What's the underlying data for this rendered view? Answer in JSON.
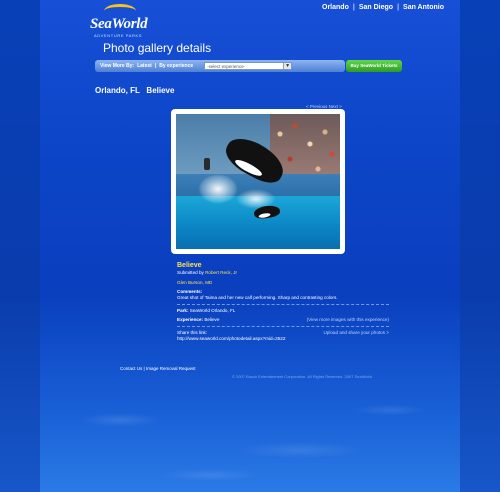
{
  "brand": {
    "logo_text": "SeaWorld",
    "logo_sub": "ADVENTURE PARKS"
  },
  "top_nav": {
    "links": [
      "Orlando",
      "San Diego",
      "San Antonio"
    ],
    "separator": "|"
  },
  "page_title": "Photo gallery details",
  "toolbar": {
    "view_more_label": "View More By:",
    "latest": "Latest",
    "separator": "|",
    "by_experience": "By experience",
    "select_value": "-select experience-",
    "select_arrow": "▼",
    "tickets_button": "Buy SeaWorld Tickets"
  },
  "heading": "Orlando, FL   Believe",
  "pager": {
    "previous": "< Previous",
    "next": "Next >"
  },
  "photo": {
    "title": "Believe",
    "submitted_label": "Submitted by",
    "submitted_by": "Robert Reck, Jr",
    "author_credit": "Glen Burson, MD",
    "comments_label": "Comments:",
    "comments": "Great shot of Taima and her new calf performing. Sharp and contrasting colors.",
    "park_label": "Park:",
    "park": "SeaWorld Orlando, FL",
    "experience_label": "Experience:",
    "experience": "Believe",
    "view_more_link": "(View more images with this experience)",
    "share_label": "Share this link:",
    "share_url": "http://www.seaworld.com/photodetail.aspx?mid=3522",
    "upload_link": "Upload and share your photos >"
  },
  "footer": {
    "contact": "Contact Us",
    "separator": "|",
    "image_removal": "Image Removal Request",
    "copyright": "© 2007 Busch Entertainment Corporation. All Rights Reserved. 2007 SeaWorld"
  }
}
